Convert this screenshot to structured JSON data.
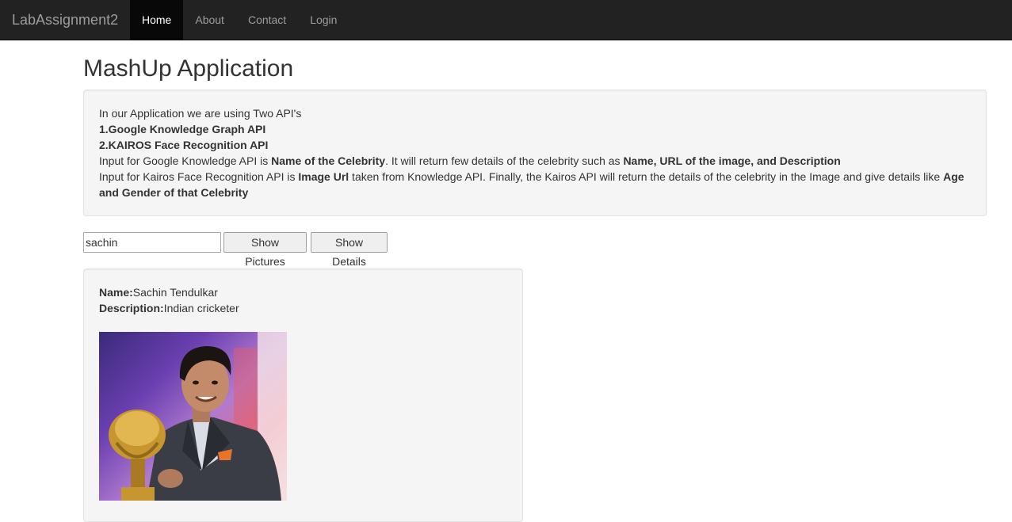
{
  "navbar": {
    "brand": "LabAssignment2",
    "items": [
      {
        "label": "Home",
        "active": true
      },
      {
        "label": "About",
        "active": false
      },
      {
        "label": "Contact",
        "active": false
      },
      {
        "label": "Login",
        "active": false
      }
    ]
  },
  "page": {
    "title": "MashUp Application"
  },
  "info": {
    "intro": "In our Application we are using Two API's",
    "api1": "1.Google Knowledge Graph API",
    "api2": "2.KAIROS Face Recognition API",
    "line3_a": "Input for Google Knowledge API is ",
    "line3_b": "Name of the Celebrity",
    "line3_c": ". It will return few details of the celebrity such as ",
    "line3_d": "Name, URL of the image, and Description",
    "line4_a": "Input for Kairos Face Recognition API is ",
    "line4_b": "Image Url",
    "line4_c": " taken from Knowledge API. Finally, the Kairos API will return the details of the celebrity in the Image and give details like ",
    "line4_d": "Age and Gender of that Celebrity"
  },
  "search": {
    "value": "sachin",
    "show_pictures_label": "Show Pictures",
    "show_details_label": "Show Details"
  },
  "result": {
    "name_label": "Name:",
    "name_value": "Sachin Tendulkar",
    "description_label": "Description:",
    "description_value": "Indian cricketer",
    "image_icon": "celebrity-photo"
  }
}
